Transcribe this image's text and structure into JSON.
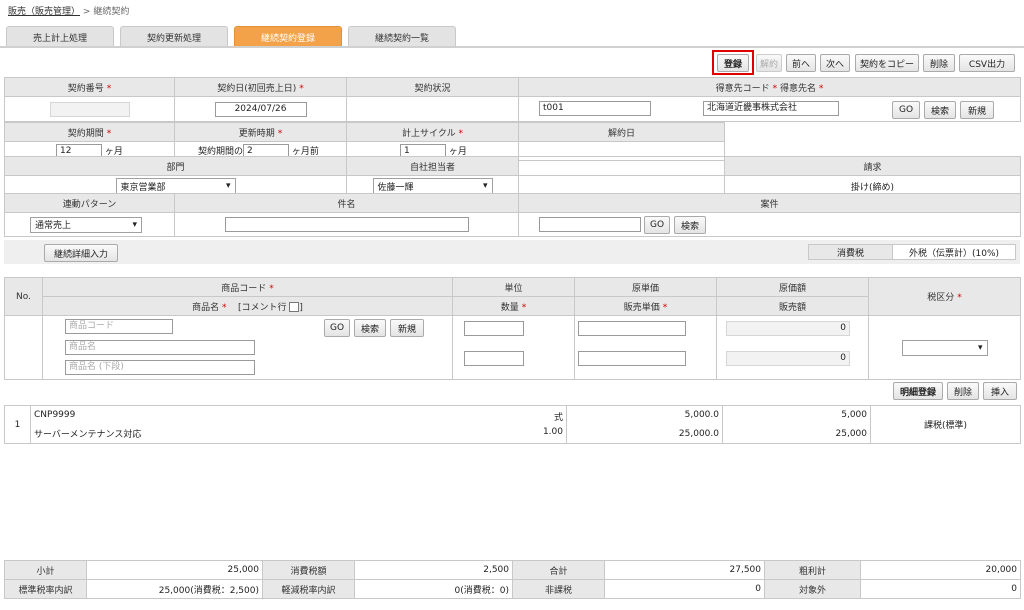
{
  "breadcrumb": {
    "parent": "販売（販売管理）",
    "sep": ">",
    "current": "継続契約"
  },
  "tabs": [
    "売上計上処理",
    "契約更新処理",
    "継続契約登録",
    "継続契約一覧"
  ],
  "toolbar": {
    "register": "登録",
    "cancel": "解約",
    "prev": "前へ",
    "next": "次へ",
    "copy": "契約をコピー",
    "delete": "削除",
    "csv": "CSV出力"
  },
  "header": {
    "contract_no": "契約番号",
    "contract_date": "契約日(初回売上日)",
    "status": "契約状況",
    "customer": "得意先コード",
    "customer_name": "得意先名",
    "period": "契約期間",
    "renewal": "更新時期",
    "cycle": "計上サイクル",
    "cancel_date": "解約日",
    "dept": "部門",
    "staff": "自社担当者",
    "billing": "請求",
    "pattern": "連動パターン",
    "subject": "件名",
    "project": "案件",
    "req": "*"
  },
  "values": {
    "contract_date": "2024/07/26",
    "customer_code": "t001",
    "customer_name": "北海道近畿事株式会社",
    "period": "12",
    "period_unit": "ヶ月",
    "renewal_prefix": "契約期間の",
    "renewal": "2",
    "renewal_unit": "ヶ月前",
    "cycle": "1",
    "cycle_unit": "ヶ月",
    "dept": "東京営業部",
    "staff": "佐藤一輝",
    "billing": "掛け(締め)",
    "pattern": "通常売上"
  },
  "buttons": {
    "go": "GO",
    "search": "検索",
    "new": "新規",
    "detail_input": "継続詳細入力",
    "line_register": "明細登録",
    "line_delete": "削除",
    "line_insert": "挿入"
  },
  "tax": {
    "label": "消費税",
    "value": "外税（伝票計）(10%)"
  },
  "lines_header": {
    "no": "No.",
    "product_code": "商品コード",
    "product_name": "商品名",
    "comment": "[コメント行",
    "unit": "単位",
    "qty": "数量",
    "cost_price": "原単価",
    "sale_price": "販売単価",
    "cost_amount": "原価額",
    "sale_amount": "販売額",
    "tax_type": "税区分"
  },
  "entry": {
    "code_ph": "商品コード",
    "name_ph": "商品名",
    "name2_ph": "商品名 (下段)",
    "cost_amount": "0",
    "sale_amount": "0"
  },
  "lines": [
    {
      "no": "1",
      "code": "CNP9999",
      "name": "サーバーメンテナンス対応",
      "unit": "式",
      "qty": "1.00",
      "cost_price": "5,000.0",
      "sale_price": "25,000.0",
      "cost_amount": "5,000",
      "sale_amount": "25,000",
      "tax": "課税(標準)"
    }
  ],
  "totals": {
    "subtotal_label": "小計",
    "subtotal": "25,000",
    "tax_label": "消費税額",
    "tax": "2,500",
    "total_label": "合計",
    "total": "27,500",
    "profit_label": "粗利計",
    "profit": "20,000",
    "std_label": "標準税率内訳",
    "std": "25,000(消費税：2,500)",
    "reduced_label": "軽減税率内訳",
    "reduced": "0(消費税：0)",
    "exempt_label": "非課税",
    "exempt": "0",
    "outside_label": "対象外",
    "outside": "0"
  }
}
